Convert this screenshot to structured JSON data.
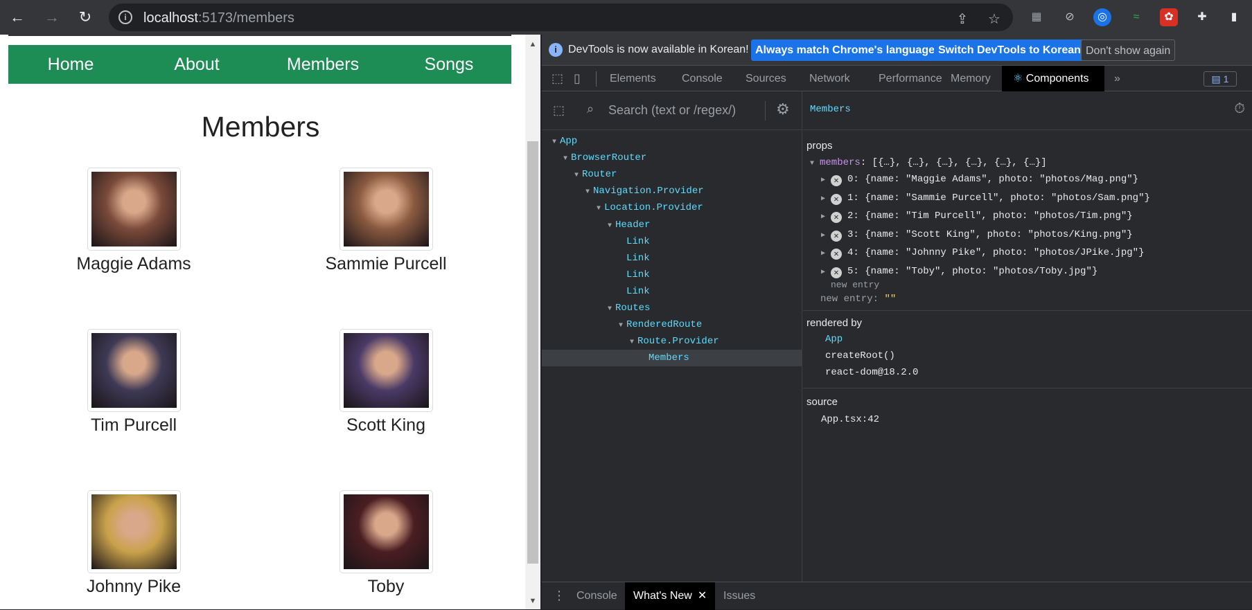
{
  "browser": {
    "url_host": "localhost",
    "url_path": ":5173/members",
    "back_icon": "←",
    "forward_icon": "→",
    "reload_icon": "↻"
  },
  "site": {
    "nav": [
      "Home",
      "About",
      "Members",
      "Songs"
    ],
    "heading": "Members",
    "members": [
      {
        "name": "Maggie Adams",
        "color": "#7a4a3a"
      },
      {
        "name": "Sammie Purcell",
        "color": "#8a5a40"
      },
      {
        "name": "Tim Purcell",
        "color": "#3e3a55"
      },
      {
        "name": "Scott King",
        "color": "#4a3a66"
      },
      {
        "name": "Johnny Pike",
        "color": "#c9a24a"
      },
      {
        "name": "Toby",
        "color": "#4a1e22"
      }
    ]
  },
  "devtools": {
    "info": {
      "message": "DevTools is now available in Korean!",
      "btn_match": "Always match Chrome's language",
      "btn_switch": "Switch DevTools to Korean",
      "btn_dismiss": "Don't show again"
    },
    "tabs": [
      "Elements",
      "Console",
      "Sources",
      "Network",
      "Performance",
      "Memory",
      "Components"
    ],
    "more_tabs": "»",
    "issues_badge": "1",
    "search_placeholder": "Search (text or /regex/)",
    "tree": [
      {
        "label": "App",
        "depth": 0,
        "expanded": true
      },
      {
        "label": "BrowserRouter",
        "depth": 1,
        "expanded": true
      },
      {
        "label": "Router",
        "depth": 2,
        "expanded": true
      },
      {
        "label": "Navigation.Provider",
        "depth": 3,
        "expanded": true
      },
      {
        "label": "Location.Provider",
        "depth": 4,
        "expanded": true
      },
      {
        "label": "Header",
        "depth": 5,
        "expanded": true
      },
      {
        "label": "Link",
        "depth": 6,
        "expanded": false
      },
      {
        "label": "Link",
        "depth": 6,
        "expanded": false
      },
      {
        "label": "Link",
        "depth": 6,
        "expanded": false
      },
      {
        "label": "Link",
        "depth": 6,
        "expanded": false
      },
      {
        "label": "Routes",
        "depth": 5,
        "expanded": true
      },
      {
        "label": "RenderedRoute",
        "depth": 6,
        "expanded": true
      },
      {
        "label": "Route.Provider",
        "depth": 7,
        "expanded": true
      },
      {
        "label": "Members",
        "depth": 8,
        "expanded": false,
        "selected": true
      }
    ],
    "selected_component": "Members",
    "props": {
      "label": "props",
      "key": "members",
      "summary": "[{…}, {…}, {…}, {…}, {…}, {…}]",
      "entries": [
        "0: {name: \"Maggie Adams\", photo: \"photos/Mag.png\"}",
        "1: {name: \"Sammie Purcell\", photo: \"photos/Sam.png\"}",
        "2: {name: \"Tim Purcell\", photo: \"photos/Tim.png\"}",
        "3: {name: \"Scott King\", photo: \"photos/King.png\"}",
        "4: {name: \"Johnny Pike\", photo: \"photos/JPike.jpg\"}",
        "5: {name: \"Toby\", photo: \"photos/Toby.jpg\"}"
      ],
      "new_entry_inner": "new entry",
      "new_entry_outer": "new entry",
      "new_entry_value": "\"\""
    },
    "rendered_by": {
      "label": "rendered by",
      "items": [
        "App",
        "createRoot()",
        "react-dom@18.2.0"
      ]
    },
    "source": {
      "label": "source",
      "value": "App.tsx:42"
    },
    "drawer_tabs": [
      "Console",
      "What's New",
      "Issues"
    ]
  }
}
